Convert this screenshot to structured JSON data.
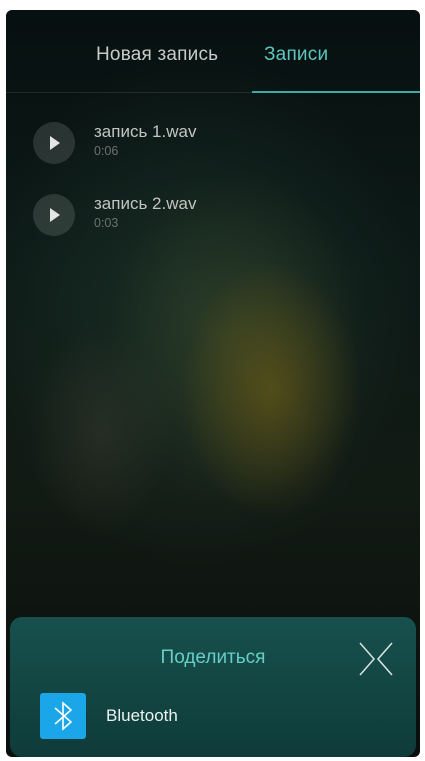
{
  "tabs": {
    "new_recording": "Новая запись",
    "recordings": "Записи",
    "active": "recordings",
    "active_color": "#5cc6c0"
  },
  "recordings": [
    {
      "name": "запись 1.wav",
      "duration": "0:06",
      "icon": "play-icon"
    },
    {
      "name": "запись 2.wav",
      "duration": "0:03",
      "icon": "play-icon"
    }
  ],
  "share_sheet": {
    "title": "Поделиться",
    "close_icon": "close-icon",
    "items": [
      {
        "label": "Bluetooth",
        "icon": "bluetooth-icon",
        "icon_color": "#1ba6ea"
      }
    ]
  }
}
